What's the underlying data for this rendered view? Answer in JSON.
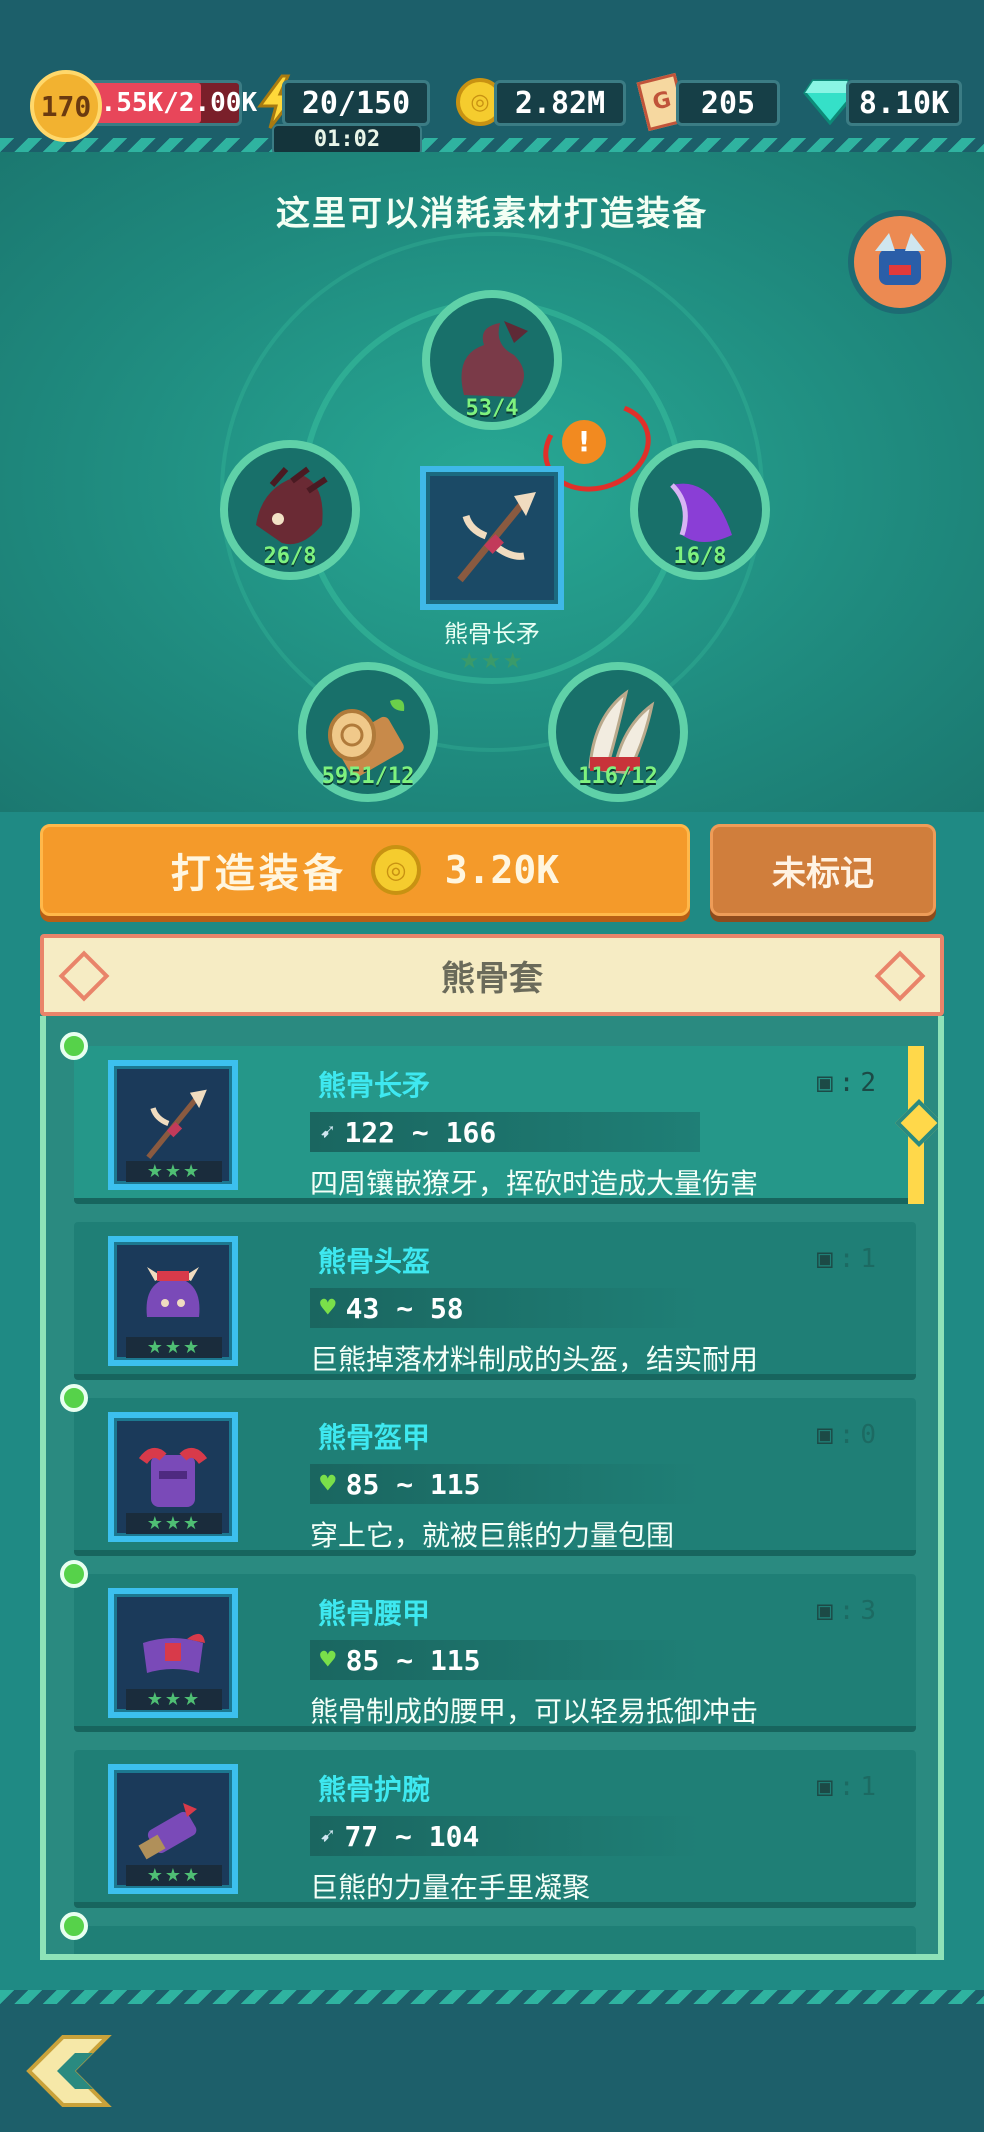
{
  "top_bar": {
    "level": "170",
    "exp": "1.55K/2.00K",
    "energy": "20/150",
    "energy_timer": "01:02",
    "gold": "2.82M",
    "tickets": "205",
    "gems": "8.10K"
  },
  "forge": {
    "heading": "这里可以消耗素材打造装备",
    "target_item": "熊骨长矛",
    "materials": [
      {
        "icon": "bear-claw-icon",
        "count": "53/4"
      },
      {
        "icon": "purple-claw-icon",
        "count": "16/8"
      },
      {
        "icon": "fang-icon",
        "count": "116/12"
      },
      {
        "icon": "wood-log-icon",
        "count": "5951/12"
      },
      {
        "icon": "horn-mask-icon",
        "count": "26/8"
      }
    ],
    "warning_symbol": "!"
  },
  "actions": {
    "craft_label": "打造装备",
    "craft_cost": "3.20K",
    "mark_label": "未标记"
  },
  "set": {
    "title": "熊骨套",
    "items": [
      {
        "name": "熊骨长矛",
        "stat_icon": "spear-icon",
        "stat": "122 ~ 166",
        "desc": "四周镶嵌獠牙，挥砍时造成大量伤害",
        "owned": "2",
        "selected": true,
        "new": true
      },
      {
        "name": "熊骨头盔",
        "stat_icon": "heart-icon",
        "stat": "43 ~ 58",
        "desc": "巨熊掉落材料制成的头盔，结实耐用",
        "owned": "1",
        "selected": false,
        "new": false
      },
      {
        "name": "熊骨盔甲",
        "stat_icon": "heart-icon",
        "stat": "85 ~ 115",
        "desc": "穿上它，就被巨熊的力量包围",
        "owned": "0",
        "selected": false,
        "new": true
      },
      {
        "name": "熊骨腰甲",
        "stat_icon": "heart-icon",
        "stat": "85 ~ 115",
        "desc": "熊骨制成的腰甲，可以轻易抵御冲击",
        "owned": "3",
        "selected": false,
        "new": true
      },
      {
        "name": "熊骨护腕",
        "stat_icon": "spear-icon",
        "stat": "77 ~ 104",
        "desc": "巨熊的力量在手里凝聚",
        "owned": "1",
        "selected": false,
        "new": false
      }
    ]
  },
  "colors": {
    "accent_orange": "#f49a2a",
    "name_cyan": "#3ee8f0",
    "count_green": "#7ff27f"
  }
}
